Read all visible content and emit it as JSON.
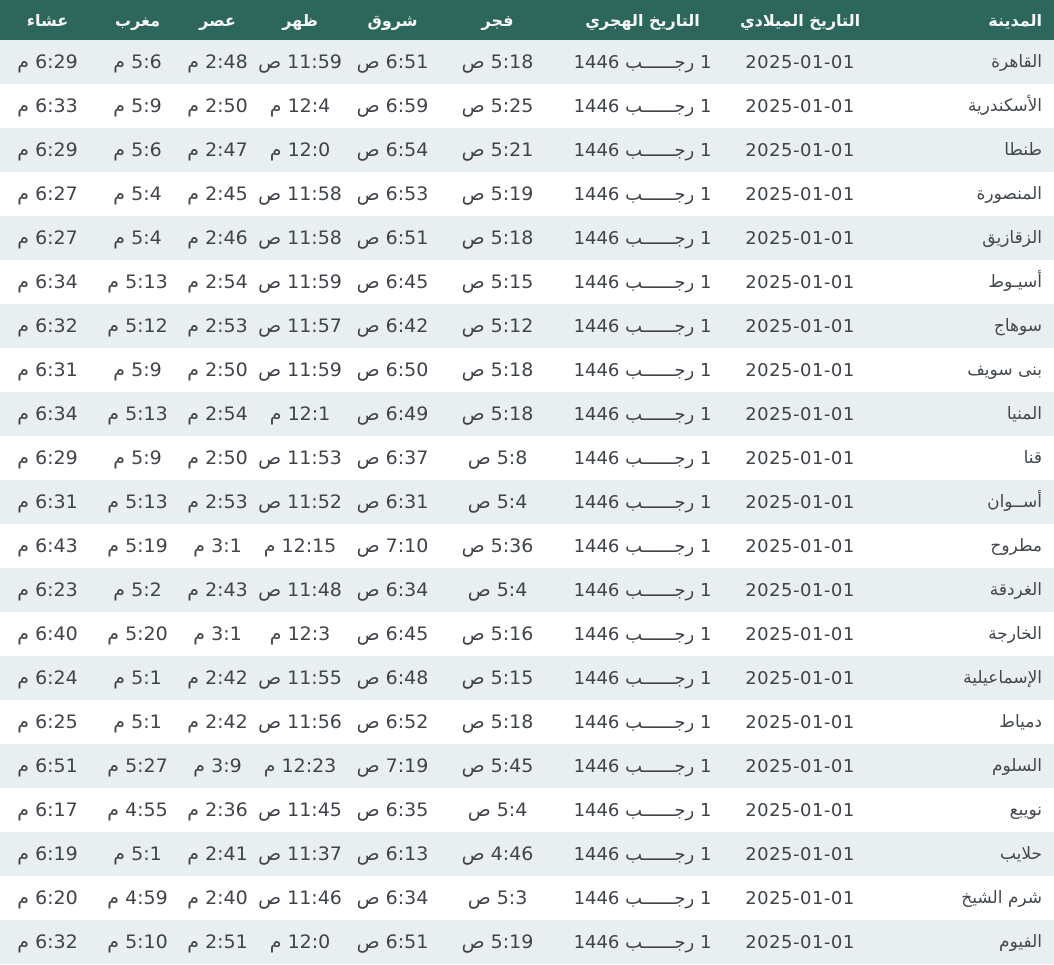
{
  "colors": {
    "header_bg": "#2d665b",
    "header_text": "#f3f6f5",
    "row_alt_bg": "#e9eef0",
    "row_bg": "#ffffff",
    "cell_text": "#3f444a",
    "bottom_line": "#3b5c7e"
  },
  "table": {
    "direction": "rtl",
    "columns": [
      {
        "key": "city",
        "label": "المدينة"
      },
      {
        "key": "gregorian_date",
        "label": "التاريخ الميلادي"
      },
      {
        "key": "hijri_date",
        "label": "التاريخ الهجري"
      },
      {
        "key": "fajr",
        "label": "فجر"
      },
      {
        "key": "sunrise",
        "label": "شروق"
      },
      {
        "key": "dhuhr",
        "label": "ظهر"
      },
      {
        "key": "asr",
        "label": "عصر"
      },
      {
        "key": "maghrib",
        "label": "مغرب"
      },
      {
        "key": "isha",
        "label": "عشاء"
      }
    ],
    "rows": [
      {
        "city": "القاهرة",
        "gregorian_date": "2025-01-01",
        "hijri_date": "1 رجــــــب 1446",
        "fajr": "5:18 ص",
        "sunrise": "6:51 ص",
        "dhuhr": "11:59 ص",
        "asr": "2:48 م",
        "maghrib": "5:6 م",
        "isha": "6:29 م"
      },
      {
        "city": "الأسكندرية",
        "gregorian_date": "2025-01-01",
        "hijri_date": "1 رجــــــب 1446",
        "fajr": "5:25 ص",
        "sunrise": "6:59 ص",
        "dhuhr": "12:4 م",
        "asr": "2:50 م",
        "maghrib": "5:9 م",
        "isha": "6:33 م"
      },
      {
        "city": "طنطا",
        "gregorian_date": "2025-01-01",
        "hijri_date": "1 رجــــــب 1446",
        "fajr": "5:21 ص",
        "sunrise": "6:54 ص",
        "dhuhr": "12:0 م",
        "asr": "2:47 م",
        "maghrib": "5:6 م",
        "isha": "6:29 م"
      },
      {
        "city": "المنصورة",
        "gregorian_date": "2025-01-01",
        "hijri_date": "1 رجــــــب 1446",
        "fajr": "5:19 ص",
        "sunrise": "6:53 ص",
        "dhuhr": "11:58 ص",
        "asr": "2:45 م",
        "maghrib": "5:4 م",
        "isha": "6:27 م"
      },
      {
        "city": "الزقازيق",
        "gregorian_date": "2025-01-01",
        "hijri_date": "1 رجــــــب 1446",
        "fajr": "5:18 ص",
        "sunrise": "6:51 ص",
        "dhuhr": "11:58 ص",
        "asr": "2:46 م",
        "maghrib": "5:4 م",
        "isha": "6:27 م"
      },
      {
        "city": "أسيـوط",
        "gregorian_date": "2025-01-01",
        "hijri_date": "1 رجــــــب 1446",
        "fajr": "5:15 ص",
        "sunrise": "6:45 ص",
        "dhuhr": "11:59 ص",
        "asr": "2:54 م",
        "maghrib": "5:13 م",
        "isha": "6:34 م"
      },
      {
        "city": "سوهاج",
        "gregorian_date": "2025-01-01",
        "hijri_date": "1 رجــــــب 1446",
        "fajr": "5:12 ص",
        "sunrise": "6:42 ص",
        "dhuhr": "11:57 ص",
        "asr": "2:53 م",
        "maghrib": "5:12 م",
        "isha": "6:32 م"
      },
      {
        "city": "بنى سويف",
        "gregorian_date": "2025-01-01",
        "hijri_date": "1 رجــــــب 1446",
        "fajr": "5:18 ص",
        "sunrise": "6:50 ص",
        "dhuhr": "11:59 ص",
        "asr": "2:50 م",
        "maghrib": "5:9 م",
        "isha": "6:31 م"
      },
      {
        "city": "المنيا",
        "gregorian_date": "2025-01-01",
        "hijri_date": "1 رجــــــب 1446",
        "fajr": "5:18 ص",
        "sunrise": "6:49 ص",
        "dhuhr": "12:1 م",
        "asr": "2:54 م",
        "maghrib": "5:13 م",
        "isha": "6:34 م"
      },
      {
        "city": "قنا",
        "gregorian_date": "2025-01-01",
        "hijri_date": "1 رجــــــب 1446",
        "fajr": "5:8 ص",
        "sunrise": "6:37 ص",
        "dhuhr": "11:53 ص",
        "asr": "2:50 م",
        "maghrib": "5:9 م",
        "isha": "6:29 م"
      },
      {
        "city": "أســوان",
        "gregorian_date": "2025-01-01",
        "hijri_date": "1 رجــــــب 1446",
        "fajr": "5:4 ص",
        "sunrise": "6:31 ص",
        "dhuhr": "11:52 ص",
        "asr": "2:53 م",
        "maghrib": "5:13 م",
        "isha": "6:31 م"
      },
      {
        "city": "مطروح",
        "gregorian_date": "2025-01-01",
        "hijri_date": "1 رجــــــب 1446",
        "fajr": "5:36 ص",
        "sunrise": "7:10 ص",
        "dhuhr": "12:15 م",
        "asr": "3:1 م",
        "maghrib": "5:19 م",
        "isha": "6:43 م"
      },
      {
        "city": "الغردقة",
        "gregorian_date": "2025-01-01",
        "hijri_date": "1 رجــــــب 1446",
        "fajr": "5:4 ص",
        "sunrise": "6:34 ص",
        "dhuhr": "11:48 ص",
        "asr": "2:43 م",
        "maghrib": "5:2 م",
        "isha": "6:23 م"
      },
      {
        "city": "الخارجة",
        "gregorian_date": "2025-01-01",
        "hijri_date": "1 رجــــــب 1446",
        "fajr": "5:16 ص",
        "sunrise": "6:45 ص",
        "dhuhr": "12:3 م",
        "asr": "3:1 م",
        "maghrib": "5:20 م",
        "isha": "6:40 م"
      },
      {
        "city": "الإسماعيلية",
        "gregorian_date": "2025-01-01",
        "hijri_date": "1 رجــــــب 1446",
        "fajr": "5:15 ص",
        "sunrise": "6:48 ص",
        "dhuhr": "11:55 ص",
        "asr": "2:42 م",
        "maghrib": "5:1 م",
        "isha": "6:24 م"
      },
      {
        "city": "دمياط",
        "gregorian_date": "2025-01-01",
        "hijri_date": "1 رجــــــب 1446",
        "fajr": "5:18 ص",
        "sunrise": "6:52 ص",
        "dhuhr": "11:56 ص",
        "asr": "2:42 م",
        "maghrib": "5:1 م",
        "isha": "6:25 م"
      },
      {
        "city": "السلوم",
        "gregorian_date": "2025-01-01",
        "hijri_date": "1 رجــــــب 1446",
        "fajr": "5:45 ص",
        "sunrise": "7:19 ص",
        "dhuhr": "12:23 م",
        "asr": "3:9 م",
        "maghrib": "5:27 م",
        "isha": "6:51 م"
      },
      {
        "city": "نويبع",
        "gregorian_date": "2025-01-01",
        "hijri_date": "1 رجــــــب 1446",
        "fajr": "5:4 ص",
        "sunrise": "6:35 ص",
        "dhuhr": "11:45 ص",
        "asr": "2:36 م",
        "maghrib": "4:55 م",
        "isha": "6:17 م"
      },
      {
        "city": "حلايب",
        "gregorian_date": "2025-01-01",
        "hijri_date": "1 رجــــــب 1446",
        "fajr": "4:46 ص",
        "sunrise": "6:13 ص",
        "dhuhr": "11:37 ص",
        "asr": "2:41 م",
        "maghrib": "5:1 م",
        "isha": "6:19 م"
      },
      {
        "city": "شرم الشيخ",
        "gregorian_date": "2025-01-01",
        "hijri_date": "1 رجــــــب 1446",
        "fajr": "5:3 ص",
        "sunrise": "6:34 ص",
        "dhuhr": "11:46 ص",
        "asr": "2:40 م",
        "maghrib": "4:59 م",
        "isha": "6:20 م"
      },
      {
        "city": "الفيوم",
        "gregorian_date": "2025-01-01",
        "hijri_date": "1 رجــــــب 1446",
        "fajr": "5:19 ص",
        "sunrise": "6:51 ص",
        "dhuhr": "12:0 م",
        "asr": "2:51 م",
        "maghrib": "5:10 م",
        "isha": "6:32 م"
      }
    ]
  }
}
